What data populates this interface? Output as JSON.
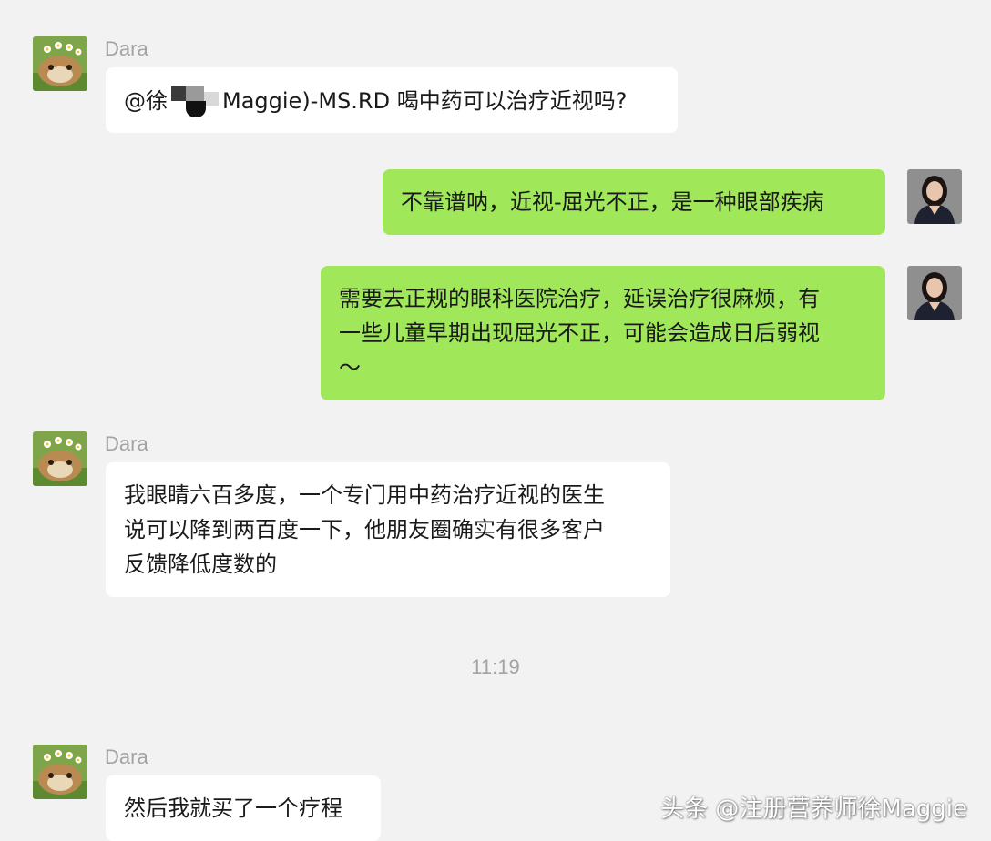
{
  "chat": {
    "time_divider": "11:19",
    "messages": [
      {
        "sender": "Dara",
        "direction": "incoming",
        "mention_prefix": "@徐",
        "text": "Maggie)-MS.RD 喝中药可以治疗近视吗?"
      },
      {
        "direction": "outgoing",
        "text": "不靠谱呐，近视-屈光不正，是一种眼部疾病"
      },
      {
        "direction": "outgoing",
        "lines": [
          "需要去正规的眼科医院治疗，延误治疗很麻烦，有",
          "一些儿童早期出现屈光不正，可能会造成日后弱视",
          "～"
        ]
      },
      {
        "sender": "Dara",
        "direction": "incoming",
        "lines": [
          "我眼睛六百多度，一个专门用中药治疗近视的医生",
          "说可以降到两百度一下，他朋友圈确实有很多客户",
          "反馈降低度数的"
        ]
      },
      {
        "sender": "Dara",
        "direction": "incoming",
        "text": "然后我就买了一个疗程"
      }
    ]
  },
  "watermark": "头条 @注册营养师徐Maggie",
  "colors": {
    "background": "#f2f2f2",
    "incoming_bubble": "#ffffff",
    "outgoing_bubble": "#a0e75a",
    "meta_text": "#a3a3a3"
  },
  "icons": {
    "sender_avatar": "guinea-pig-avatar",
    "self_avatar": "woman-portrait-avatar"
  }
}
